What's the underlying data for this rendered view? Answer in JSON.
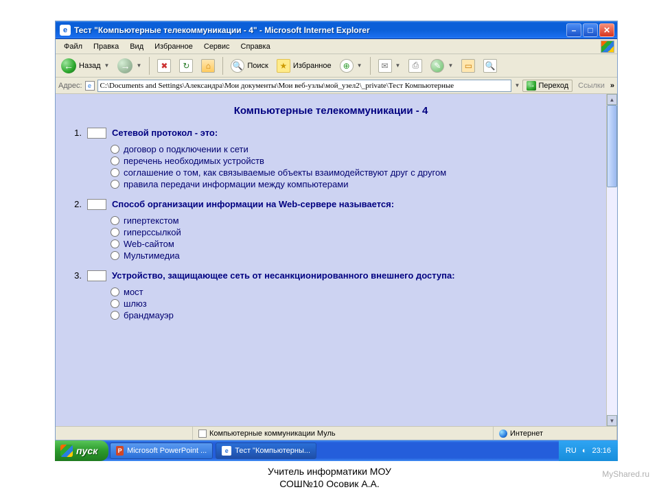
{
  "window": {
    "title": "Тест \"Компьютерные телекоммуникации - 4\" - Microsoft Internet Explorer"
  },
  "menu": {
    "items": [
      "Файл",
      "Правка",
      "Вид",
      "Избранное",
      "Сервис",
      "Справка"
    ]
  },
  "toolbar": {
    "back": "Назад",
    "search": "Поиск",
    "favorites": "Избранное"
  },
  "addressbar": {
    "label": "Адрес:",
    "value": "C:\\Documents and Settings\\Александра\\Мои документы\\Мои веб-узлы\\мой_узел2\\_private\\Тест Компьютерные",
    "go": "Переход",
    "links": "Ссылки"
  },
  "page": {
    "title": "Компьютерные телекоммуникации - 4",
    "questions": [
      {
        "num": "1.",
        "text": "Сетевой протокол - это:",
        "options": [
          "договор о подключении к сети",
          "перечень необходимых устройств",
          "соглашение о том, как связываемые объекты взаимодействуют друг с другом",
          "правила передачи информации между компьютерами"
        ]
      },
      {
        "num": "2.",
        "text": "Способ организации информации на  Web-сервере называется:",
        "options": [
          "гипертекстом",
          "гиперссылкой",
          "Web-сайтом",
          "Мультимедиа"
        ]
      },
      {
        "num": "3.",
        "text": "Устройство, защищающее сеть от несанкционированного внешнего доступа:",
        "options": [
          "мост",
          "шлюз",
          "брандмауэр"
        ]
      }
    ]
  },
  "statusbar": {
    "center": "Компьютерные коммуникации Муль",
    "zone": "Интернет"
  },
  "taskbar": {
    "start": "пуск",
    "items": [
      "Microsoft PowerPoint ...",
      "Тест \"Компьютерны..."
    ],
    "lang": "RU",
    "time": "23:16"
  },
  "caption": {
    "line1": "Учитель информатики МОУ",
    "line2": "СОШ№10 Осовик А.А."
  },
  "watermark": "MyShared.ru"
}
